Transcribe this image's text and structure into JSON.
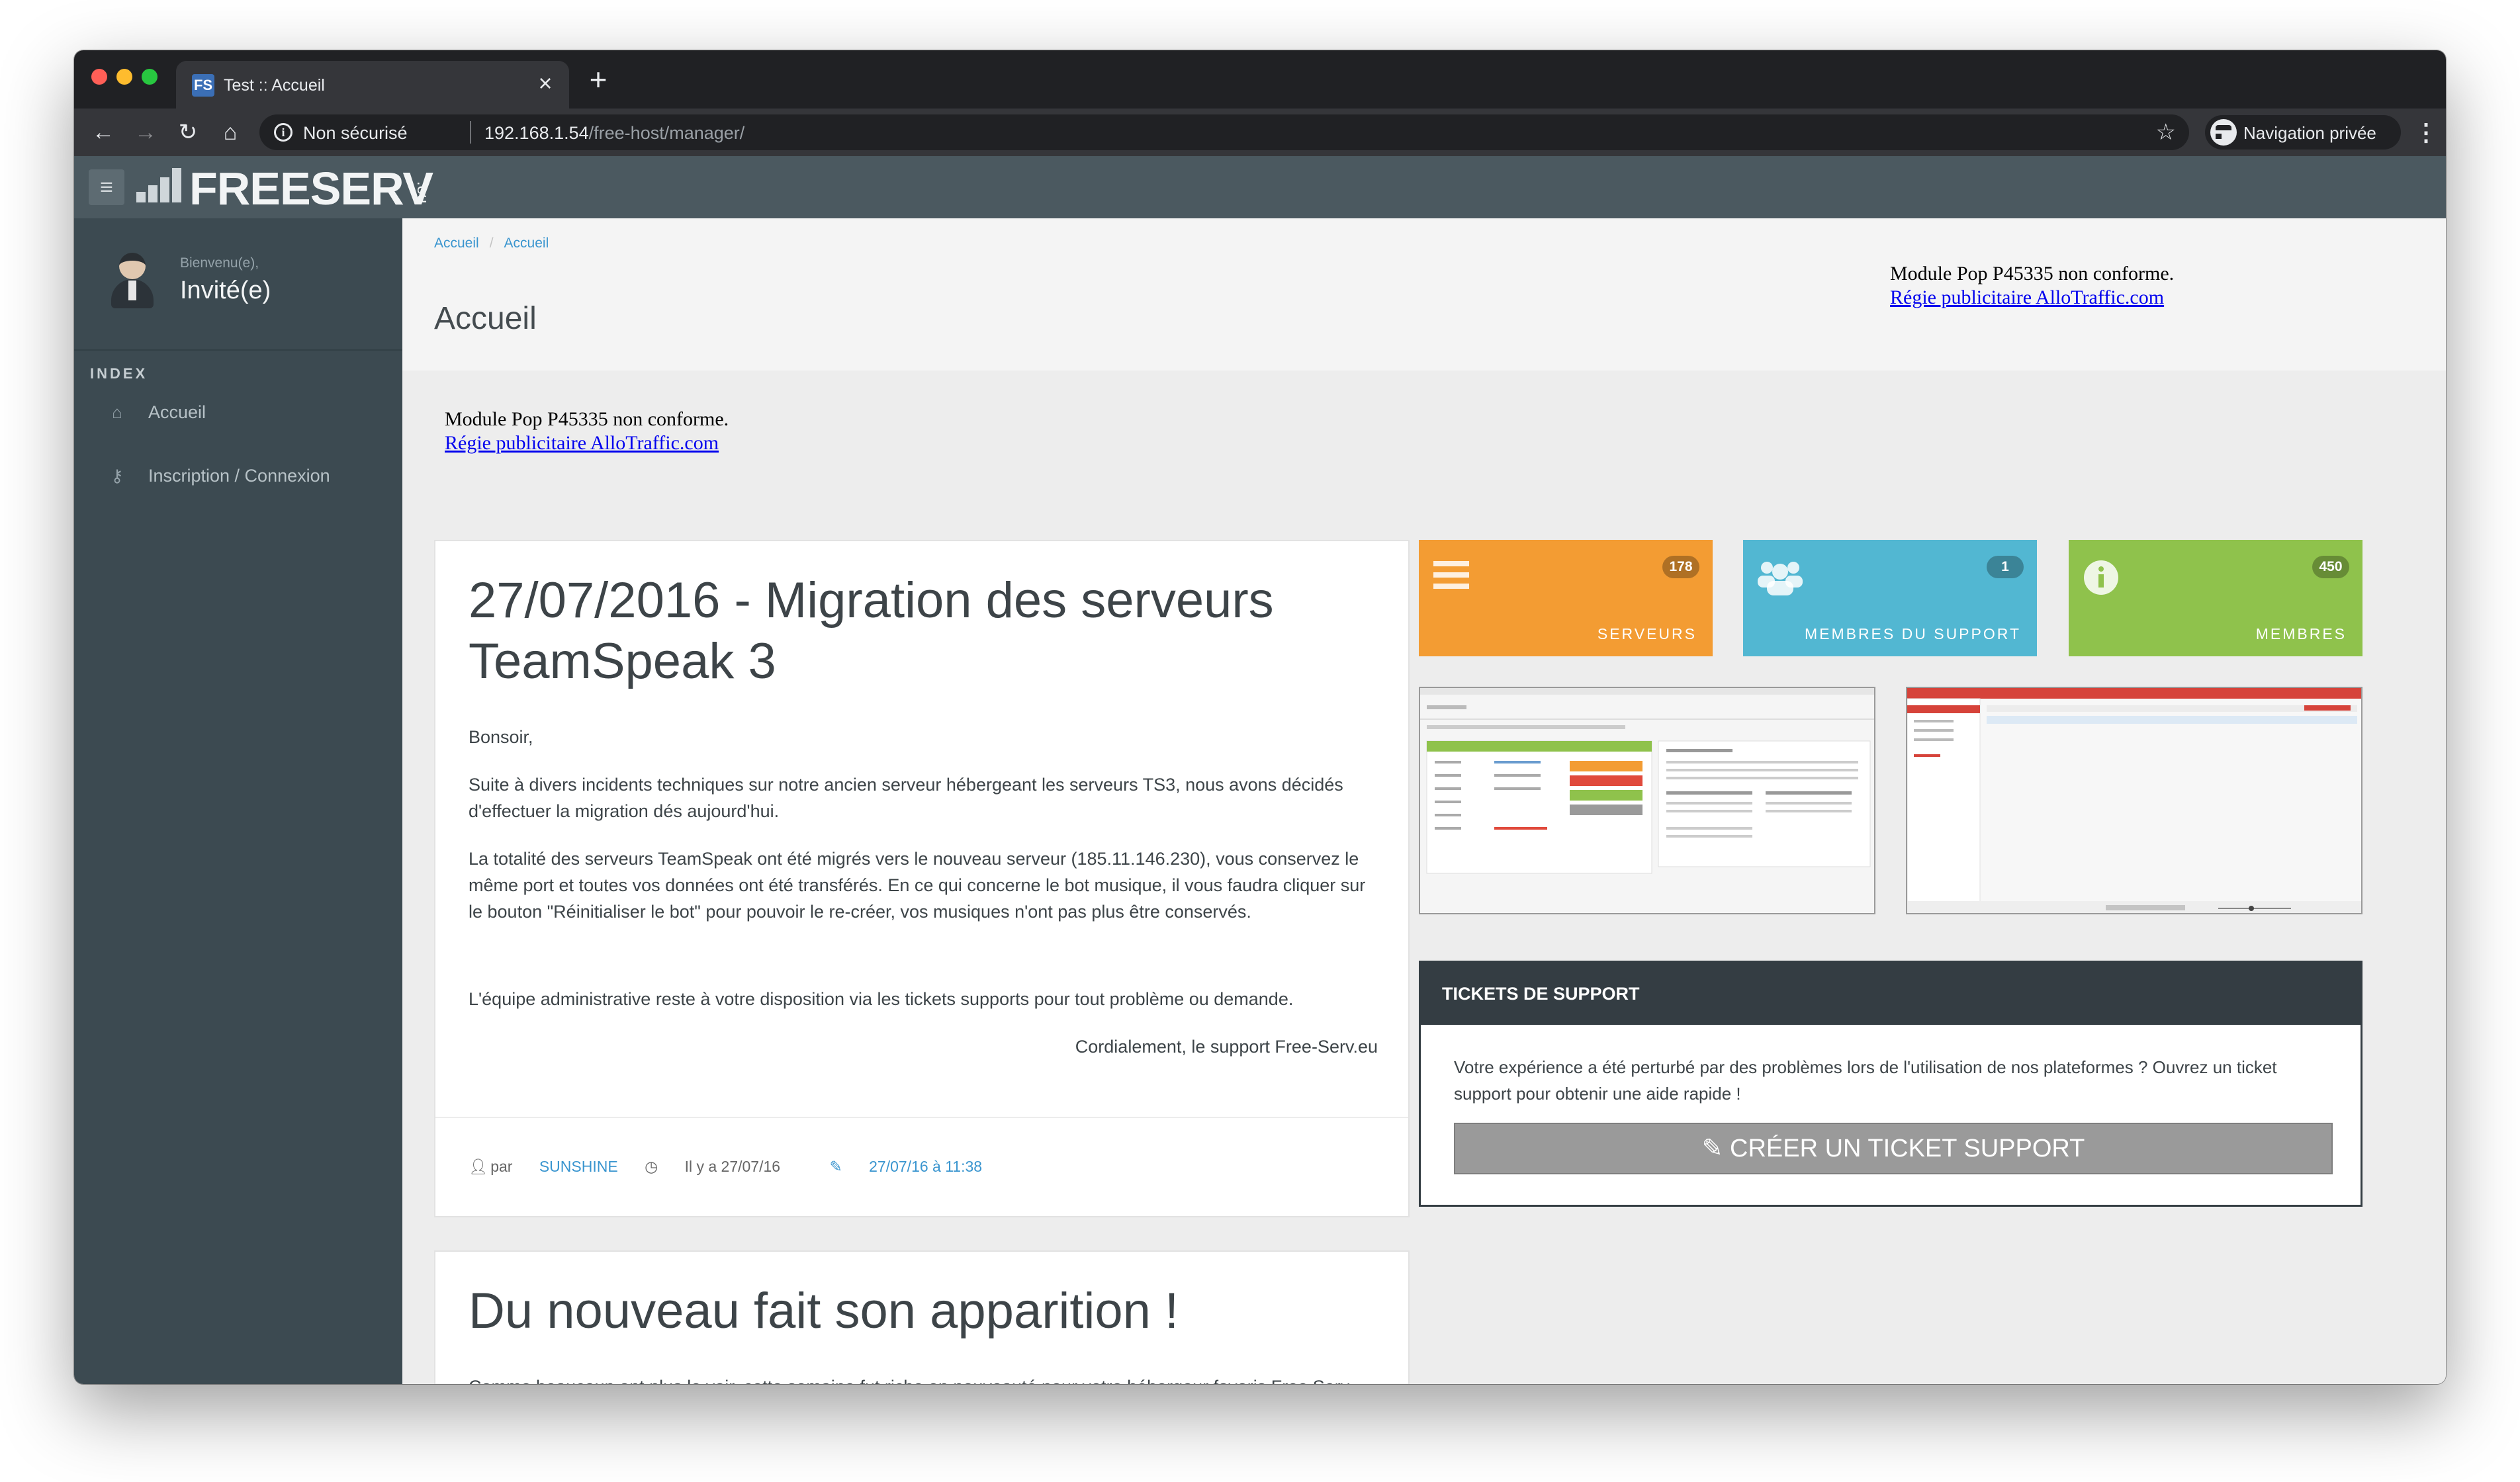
{
  "browser": {
    "tab_title": "Test :: Accueil",
    "tab_favicon": "FS",
    "new_tab": "+",
    "security_label": "Non sécurisé",
    "url_host": "192.168.1.54",
    "url_path": "/free-host/manager/",
    "incognito_label": "Navigation privée"
  },
  "site": {
    "logo_text": "FREESERV",
    "logo_suffix": ".eu"
  },
  "sidebar": {
    "welcome": "Bienvenu(e),",
    "username": "Invité(e)",
    "heading": "INDEX",
    "items": [
      {
        "label": "Accueil",
        "icon": "home-icon"
      },
      {
        "label": "Inscription / Connexion",
        "icon": "key-icon"
      }
    ]
  },
  "breadcrumb": [
    "Accueil",
    "Accueil"
  ],
  "page_title": "Accueil",
  "ads": {
    "line1": "Module Pop P45335 non conforme.",
    "link": "Régie publicitaire AlloTraffic.com"
  },
  "posts": [
    {
      "title": "27/07/2016 - Migration des serveurs TeamSpeak 3",
      "paragraphs": [
        "Bonsoir,",
        "Suite à divers incidents techniques sur notre ancien serveur hébergeant les serveurs TS3, nous avons décidés d'effectuer la migration dés aujourd'hui.",
        "La totalité des serveurs TeamSpeak ont été migrés vers le nouveau serveur (185.11.146.230), vous conservez le même port et toutes vos données ont été transférés. En ce qui concerne le bot musique, il vous faudra cliquer sur le bouton \"Réinitialiser le bot\" pour pouvoir le re-créer, vos musiques n'ont pas plus être conservés.",
        "L'équipe administrative reste à votre disposition via les tickets supports pour tout problème ou demande."
      ],
      "signature": "Cordialement, le support Free-Serv.eu",
      "author_prefix": "par",
      "author": "SUNSHINE",
      "age": "Il y a 27/07/16",
      "date_link": "27/07/16 à 11:38"
    },
    {
      "title": "Du nouveau fait son apparition !",
      "paragraphs": [
        "Comme beaucoup ont plus le voir, cette semaine fut riche en nouveauté pour votre hébergeur favoris Free Serv. Ci-dessous nous vous détaillerons la liste des changements mits en places ou qui le seront prochainement."
      ]
    }
  ],
  "stats": [
    {
      "label": "SERVEURS",
      "count": "178",
      "color": "#f39c33",
      "icon": "list-icon"
    },
    {
      "label": "MEMBRES DU SUPPORT",
      "count": "1",
      "color": "#52b7d2",
      "icon": "users-icon"
    },
    {
      "label": "MEMBRES",
      "count": "450",
      "color": "#8fc24c",
      "icon": "info-icon"
    }
  ],
  "support": {
    "title": "TICKETS DE SUPPORT",
    "text": "Votre expérience a été perturbé par des problèmes lors de l'utilisation de nos plateformes ? Ouvrez un ticket support pour obtenir une aide rapide !",
    "button": "CRÉER UN TICKET SUPPORT"
  }
}
